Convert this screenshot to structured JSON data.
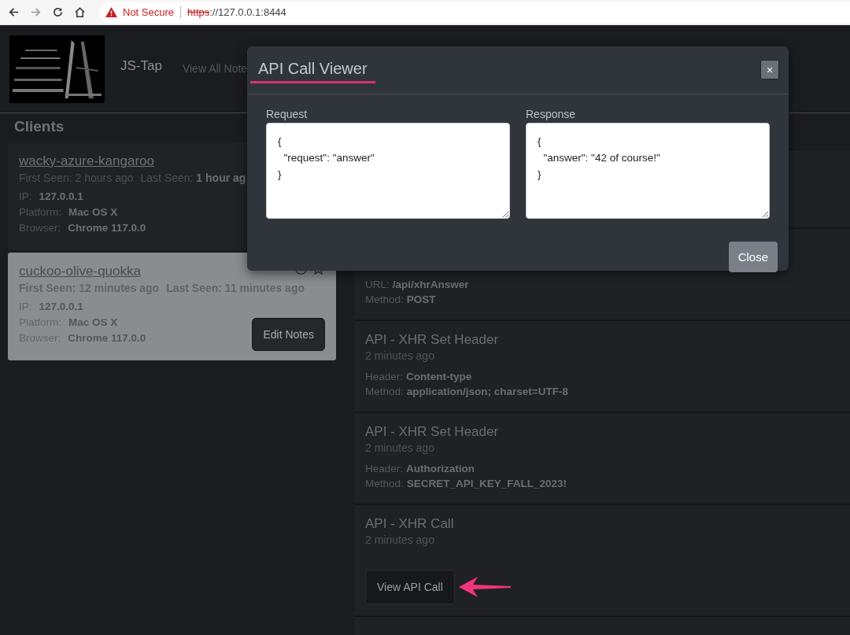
{
  "browser": {
    "not_secure": true,
    "security_label": "Not Secure",
    "scheme": "https",
    "address": "://127.0.0.1:8444"
  },
  "header": {
    "app_name": "JS-Tap",
    "nav_link": "View All Note"
  },
  "clients": {
    "title": "Clients",
    "items": [
      {
        "name": "wacky-azure-kangaroo",
        "selected": false,
        "first_seen": "First Seen: 2 hours ago",
        "last_seen": "Last Seen: **1 hour ag**",
        "ip_label": "IP:",
        "ip": "127.0.0.1",
        "platform_label": "Platform:",
        "platform": "Mac OS X",
        "browser_label": "Browser:",
        "browser": "Chrome 117.0.0"
      },
      {
        "name": "cuckoo-olive-quokka",
        "selected": true,
        "first_seen": "First Seen: 12 minutes ago",
        "last_seen": "Last Seen: 11 minutes ago",
        "ip_label": "IP:",
        "ip": "127.0.0.1",
        "platform_label": "Platform:",
        "platform": "Mac OS X",
        "browser_label": "Browser:",
        "browser": "Chrome 117.0.0",
        "button": "Edit Notes"
      }
    ]
  },
  "events": [
    {
      "details": [
        {
          "label": "URL:",
          "value": "/api/xhrAnswer"
        },
        {
          "label": "Method:",
          "value": "POST"
        }
      ]
    },
    {
      "title": "API - XHR Set Header",
      "time": "2 minutes ago",
      "details": [
        {
          "label": "Header:",
          "value": "Content-type"
        },
        {
          "label": "Method:",
          "value": "application/json; charset=UTF-8"
        }
      ]
    },
    {
      "title": "API - XHR Set Header",
      "time": "2 minutes ago",
      "details": [
        {
          "label": "Header:",
          "value": "Authorization"
        },
        {
          "label": "Method:",
          "value": "SECRET_API_KEY_FALL_2023!"
        }
      ]
    },
    {
      "title": "API - XHR Call",
      "time": "2 minutes ago",
      "button": "View API Call"
    }
  ],
  "modal": {
    "title": "API Call Viewer",
    "close_icon": "×",
    "request_label": "Request",
    "request": "{\n  \"request\": \"answer\"\n}",
    "response_label": "Response",
    "response": "{\n  \"answer\": \"42 of course!\"\n}",
    "close_button": "Close"
  }
}
